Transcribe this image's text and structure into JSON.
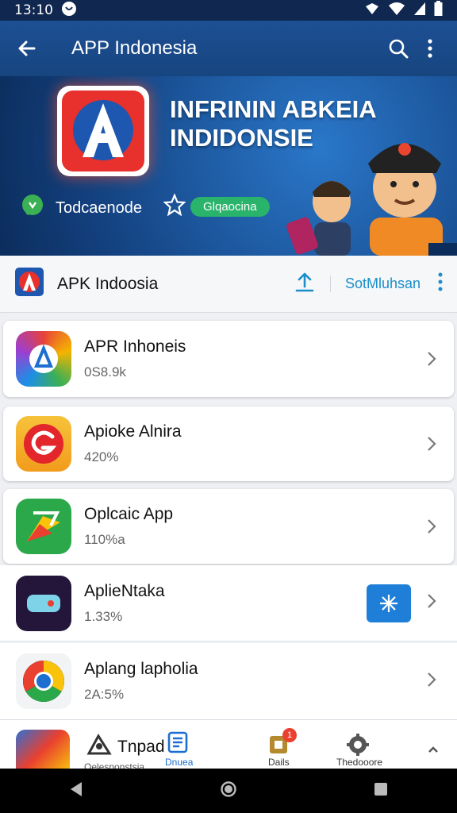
{
  "status_bar": {
    "time": "13:10"
  },
  "app_bar": {
    "title": "APP Indonesia"
  },
  "banner": {
    "headline_line1": "INFRININ ABKEIA",
    "headline_line2": "INDIDONSIE",
    "left_label": "Todcaenode",
    "right_pill": "Glqaocina"
  },
  "section": {
    "title": "APK Indoosia",
    "action": "SotMluhsan"
  },
  "apps": [
    {
      "name": "APR Inhoneis",
      "meta": "0S8.9k"
    },
    {
      "name": "Apioke Alnira",
      "meta": "420%"
    },
    {
      "name": "Oplcaic App",
      "meta": "110%a"
    },
    {
      "name": "AplieNtaka",
      "meta": "1.33%"
    },
    {
      "name": "Aplang lapholia",
      "meta": "2A:5%"
    }
  ],
  "partial_item": {
    "name": "Tnpad",
    "meta": "Qelesnonstsia"
  },
  "bottom_nav": {
    "items": [
      {
        "label": "Dnuea"
      },
      {
        "label": "Dails"
      },
      {
        "label": "Thedooore"
      }
    ],
    "badge": "1"
  },
  "colors": {
    "app_bar": "#1d4f94",
    "accent": "#1b8ec9",
    "pill_green": "#29b36b",
    "install_blue": "#1f7fd8"
  }
}
